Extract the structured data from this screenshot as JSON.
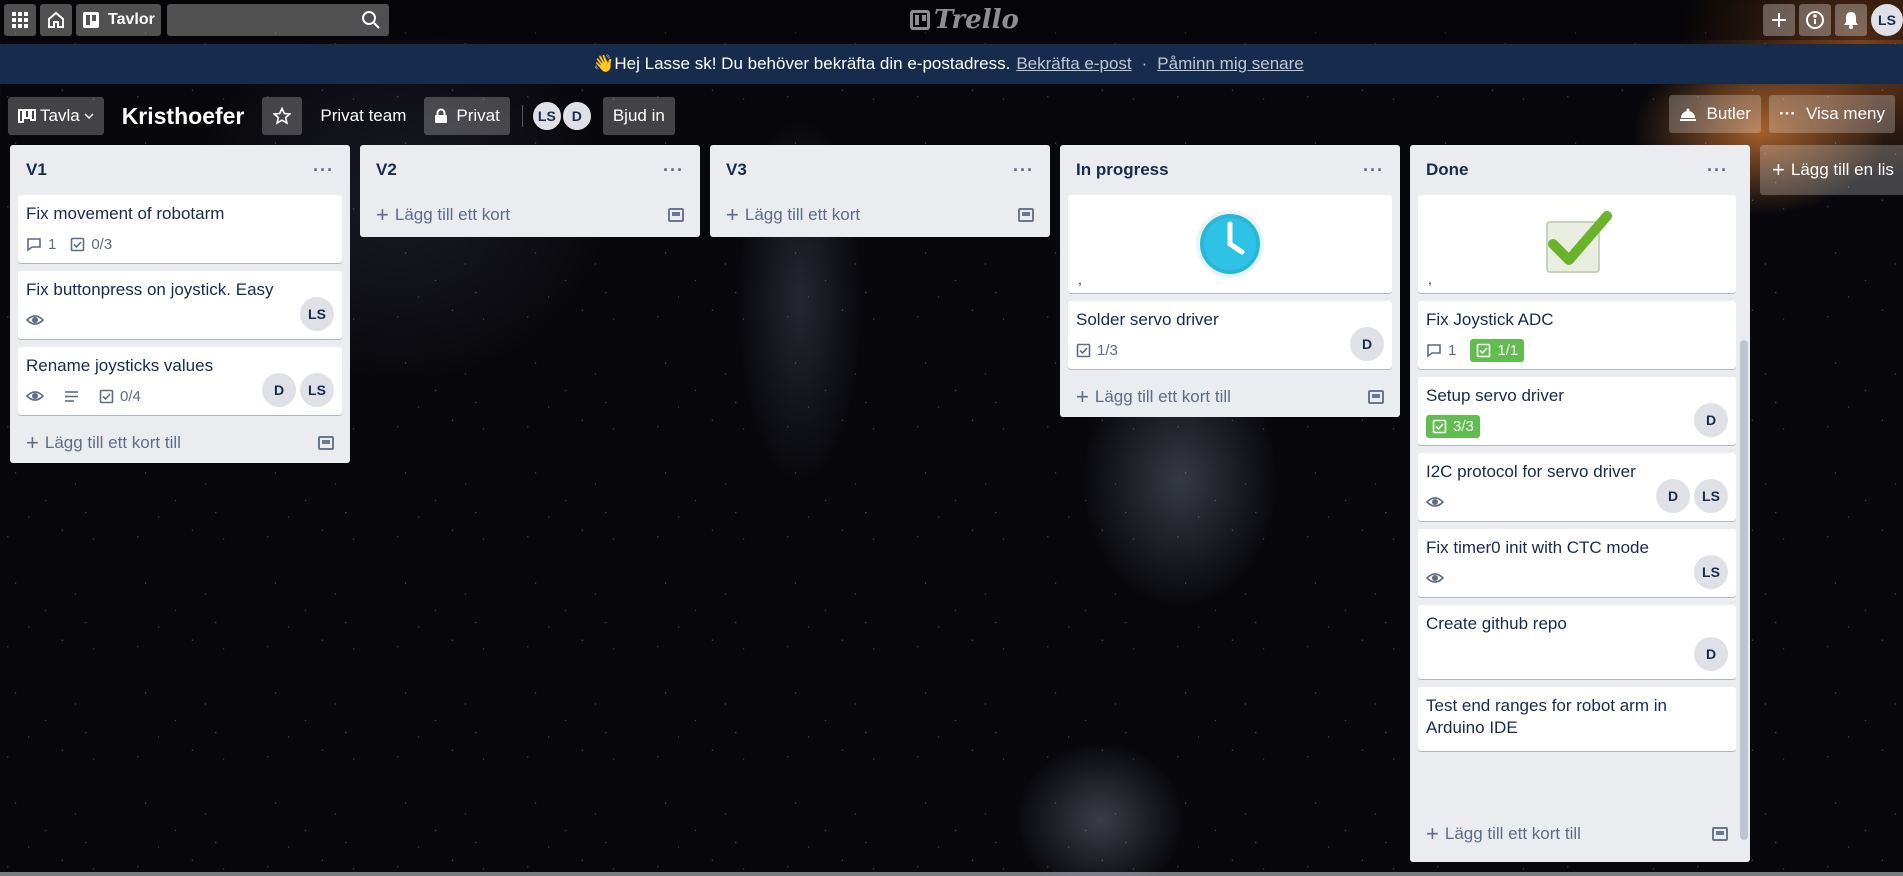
{
  "topbar": {
    "boards_label": "Tavlor",
    "logo_text": "Trello",
    "user_initials": "LS"
  },
  "banner": {
    "emoji": "👋",
    "message": "Hej Lasse sk! Du behöver bekräfta din e-postadress.",
    "confirm_link": "Bekräfta e-post",
    "separator": "·",
    "remind_link": "Påminn mig senare"
  },
  "board": {
    "view_label": "Tavla",
    "title": "Kristhoefer",
    "team": "Privat team",
    "visibility": "Privat",
    "members": [
      "LS",
      "D"
    ],
    "invite": "Bjud in",
    "butler": "Butler",
    "menu": "Visa meny"
  },
  "lists": [
    {
      "title": "V1",
      "cards": [
        {
          "title": "Fix movement of robotarm",
          "comments": "1",
          "checklist": "0/3"
        },
        {
          "title": "Fix buttonpress on joystick. Easy",
          "members": [
            "LS"
          ]
        },
        {
          "title": "Rename joysticks values",
          "checklist": "0/4",
          "members": [
            "D",
            "LS"
          ]
        }
      ],
      "add": "Lägg till ett kort till"
    },
    {
      "title": "V2",
      "add": "Lägg till ett kort"
    },
    {
      "title": "V3",
      "add": "Lägg till ett kort"
    },
    {
      "title": "In progress",
      "cover_text": ",",
      "cards": [
        {
          "title": "Solder servo driver",
          "checklist": "1/3",
          "members": [
            "D"
          ]
        }
      ],
      "add": "Lägg till ett kort till"
    },
    {
      "title": "Done",
      "cover_text": ",",
      "cards": [
        {
          "title": "Fix Joystick ADC",
          "comments": "1",
          "checklist": "1/1"
        },
        {
          "title": "Setup servo driver",
          "checklist": "3/3",
          "members": [
            "D"
          ]
        },
        {
          "title": "I2C protocol for servo driver",
          "members": [
            "D",
            "LS"
          ]
        },
        {
          "title": "Fix timer0 init with CTC mode",
          "members": [
            "LS"
          ]
        },
        {
          "title": "Create github repo",
          "members": [
            "D"
          ]
        },
        {
          "title": "Test end ranges for robot arm in Arduino IDE"
        }
      ],
      "add": "Lägg till ett kort till"
    }
  ],
  "add_list": "Lägg till en lis",
  "colors": {
    "list_bg": "#ebecf0",
    "banner_bg": "#172b4d",
    "done_badge": "#61bd4f",
    "clock_icon": "#29b6d9",
    "check_icon": "#6ab32b"
  }
}
